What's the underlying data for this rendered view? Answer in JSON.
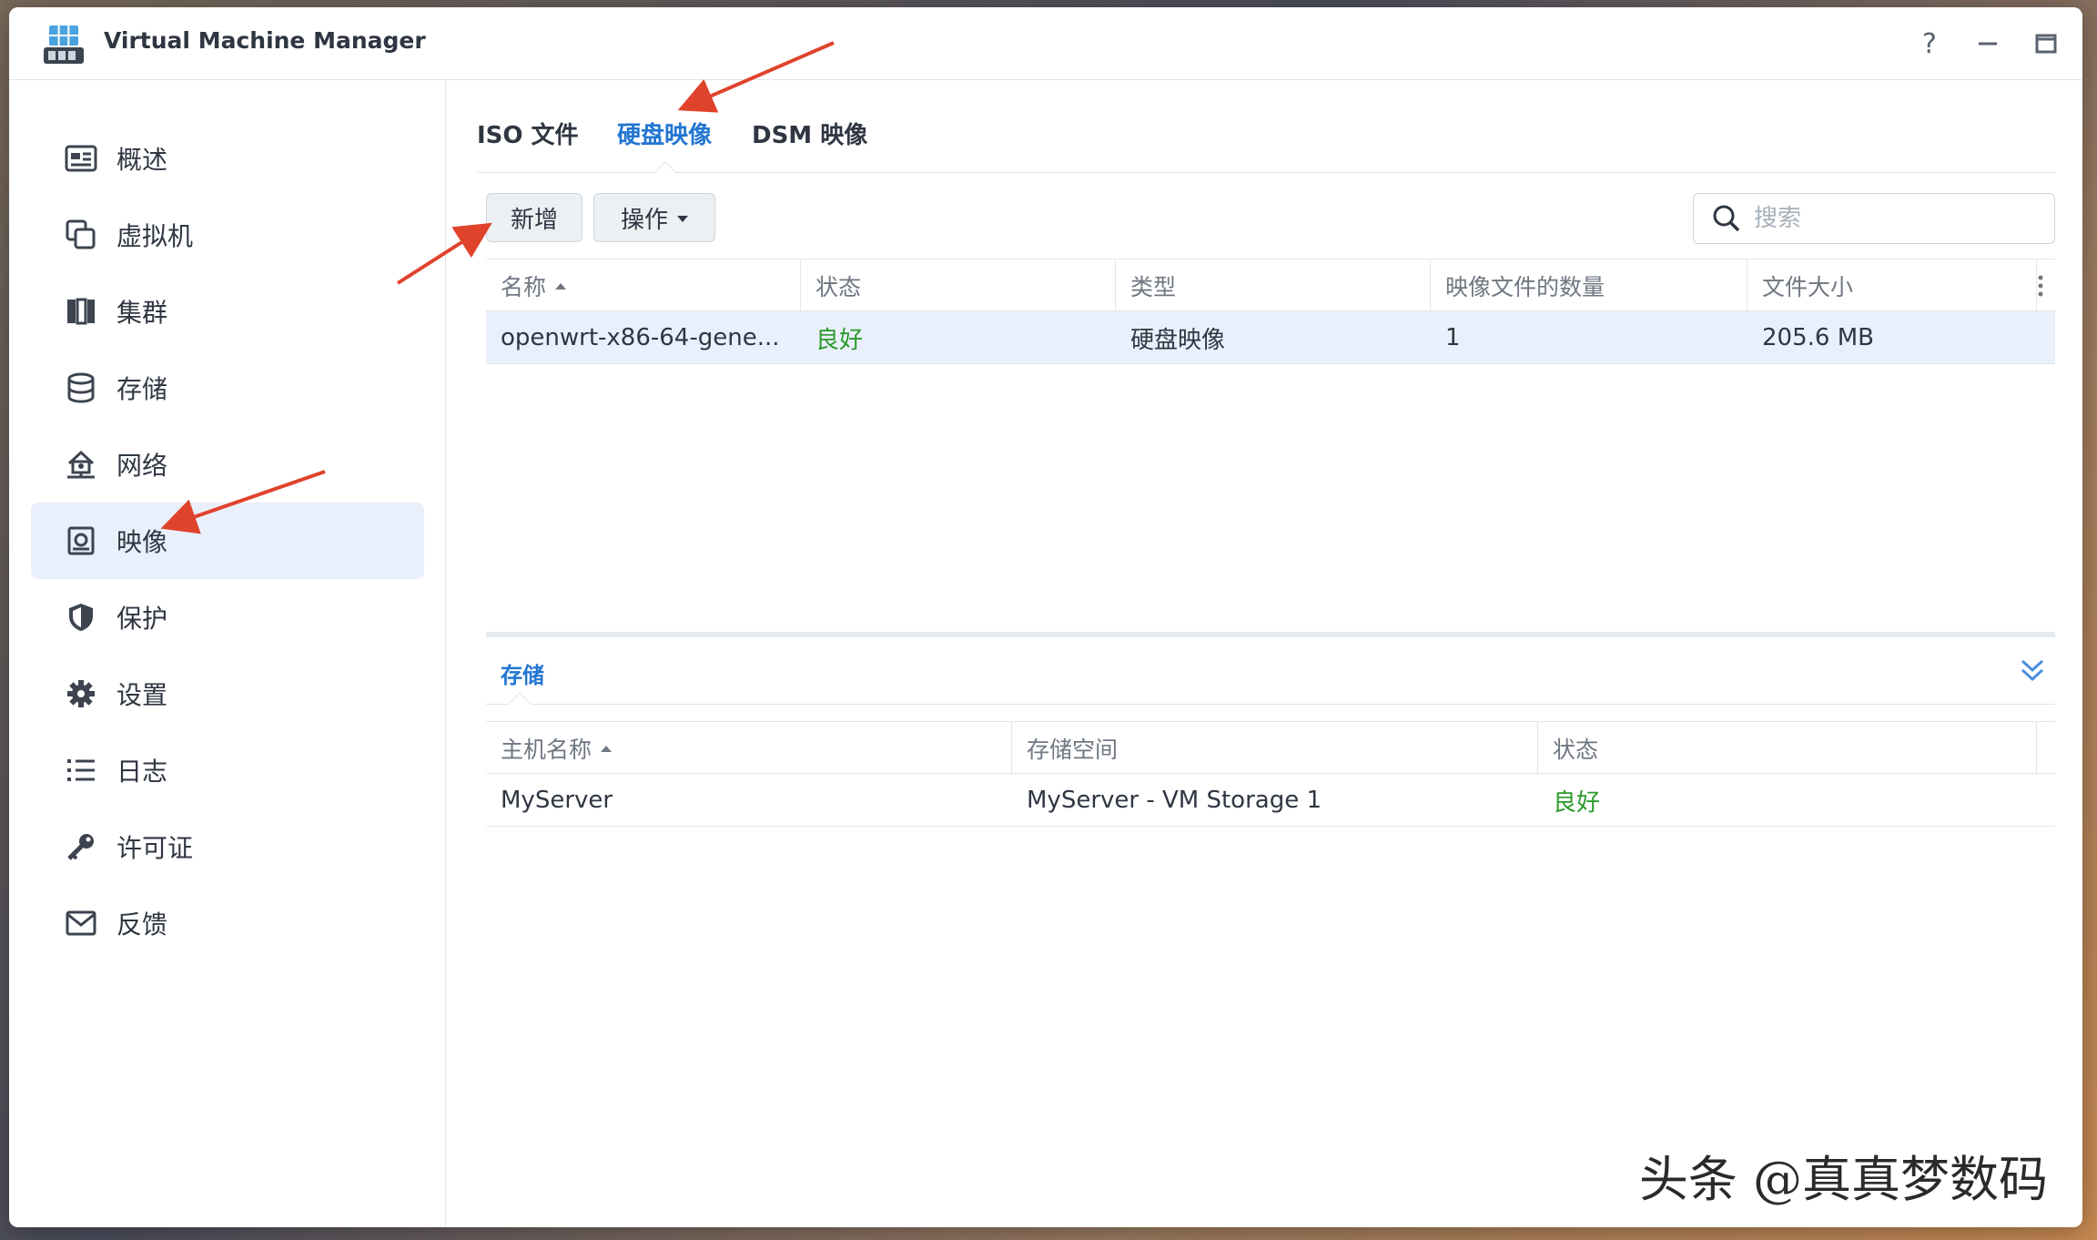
{
  "window": {
    "title": "Virtual Machine Manager",
    "controls": {
      "help": "?",
      "minimize": "—",
      "maximize": "□",
      "close": "✕"
    }
  },
  "sidebar": {
    "items": [
      {
        "label": "概述",
        "icon": "overview-icon"
      },
      {
        "label": "虚拟机",
        "icon": "virtual-machine-icon"
      },
      {
        "label": "集群",
        "icon": "cluster-icon"
      },
      {
        "label": "存储",
        "icon": "storage-icon"
      },
      {
        "label": "网络",
        "icon": "network-icon"
      },
      {
        "label": "映像",
        "icon": "image-icon",
        "active": true
      },
      {
        "label": "保护",
        "icon": "shield-icon"
      },
      {
        "label": "设置",
        "icon": "gear-icon"
      },
      {
        "label": "日志",
        "icon": "list-icon"
      },
      {
        "label": "许可证",
        "icon": "key-icon"
      },
      {
        "label": "反馈",
        "icon": "mail-icon"
      }
    ]
  },
  "tabs": [
    {
      "label": "ISO 文件"
    },
    {
      "label": "硬盘映像",
      "active": true
    },
    {
      "label": "DSM 映像"
    }
  ],
  "toolbar": {
    "add_label": "新增",
    "action_label": "操作",
    "search_placeholder": "搜索"
  },
  "images_table": {
    "columns": [
      "名称",
      "状态",
      "类型",
      "映像文件的数量",
      "文件大小"
    ],
    "rows": [
      {
        "name": "openwrt-x86-64-gene...",
        "status": "良好",
        "type": "硬盘映像",
        "count": "1",
        "size": "205.6 MB"
      }
    ]
  },
  "storage_panel": {
    "title": "存储",
    "columns": [
      "主机名称",
      "存储空间",
      "状态"
    ],
    "rows": [
      {
        "host": "MyServer",
        "volume": "MyServer - VM Storage 1",
        "status": "良好"
      }
    ]
  },
  "watermark": "头条 @真真梦数码",
  "colors": {
    "accent": "#2276d2",
    "ok": "#2a9a2a",
    "active_bg": "#e9f0fb",
    "arrow": "#e0432c"
  }
}
